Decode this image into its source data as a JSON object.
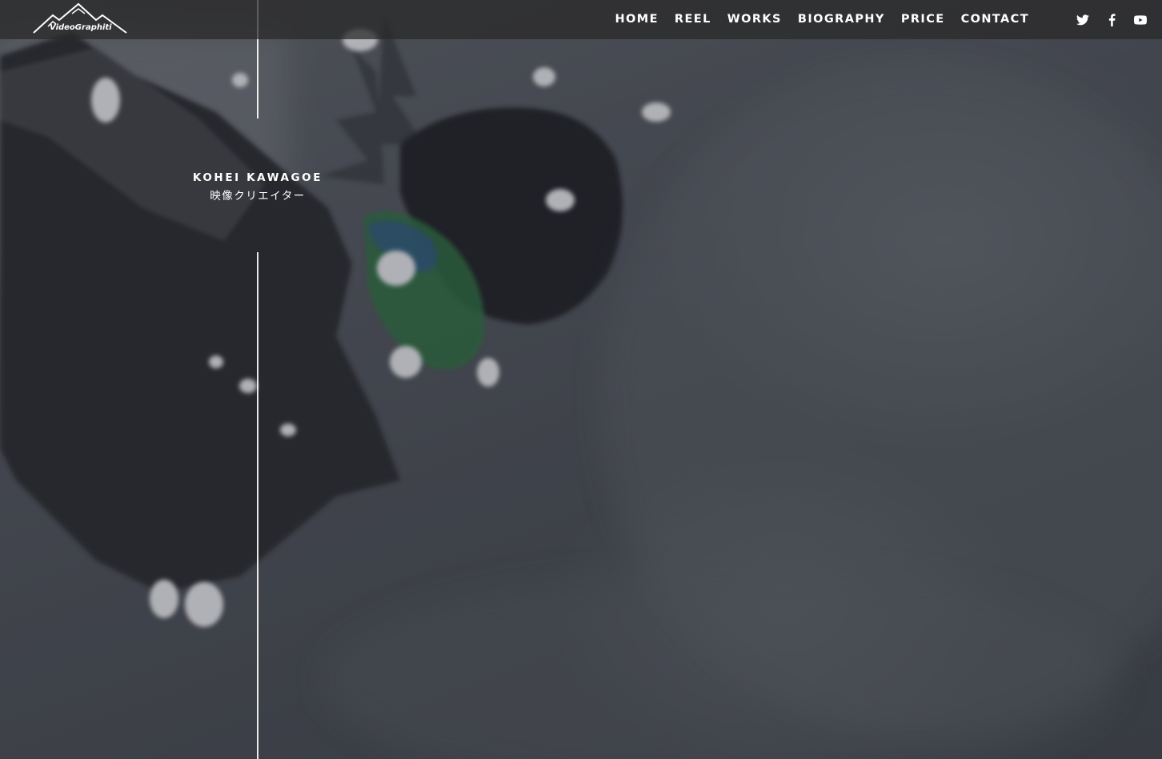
{
  "header": {
    "logo_text": "VideoGraphiti",
    "nav": [
      {
        "label": "HOME"
      },
      {
        "label": "REEL"
      },
      {
        "label": "WORKS"
      },
      {
        "label": "BIOGRAPHY"
      },
      {
        "label": "PRICE"
      },
      {
        "label": "CONTACT"
      }
    ],
    "social": [
      {
        "icon": "twitter-icon"
      },
      {
        "icon": "facebook-icon"
      },
      {
        "icon": "youtube-icon"
      }
    ]
  },
  "hero": {
    "name": "KOHEI KAWAGOE",
    "role": "映像クリエイター",
    "background": "snowboarder-in-powder-snow-video"
  },
  "colors": {
    "nav_bar": "#282828",
    "text": "#ffffff",
    "line": "#ffffff"
  }
}
